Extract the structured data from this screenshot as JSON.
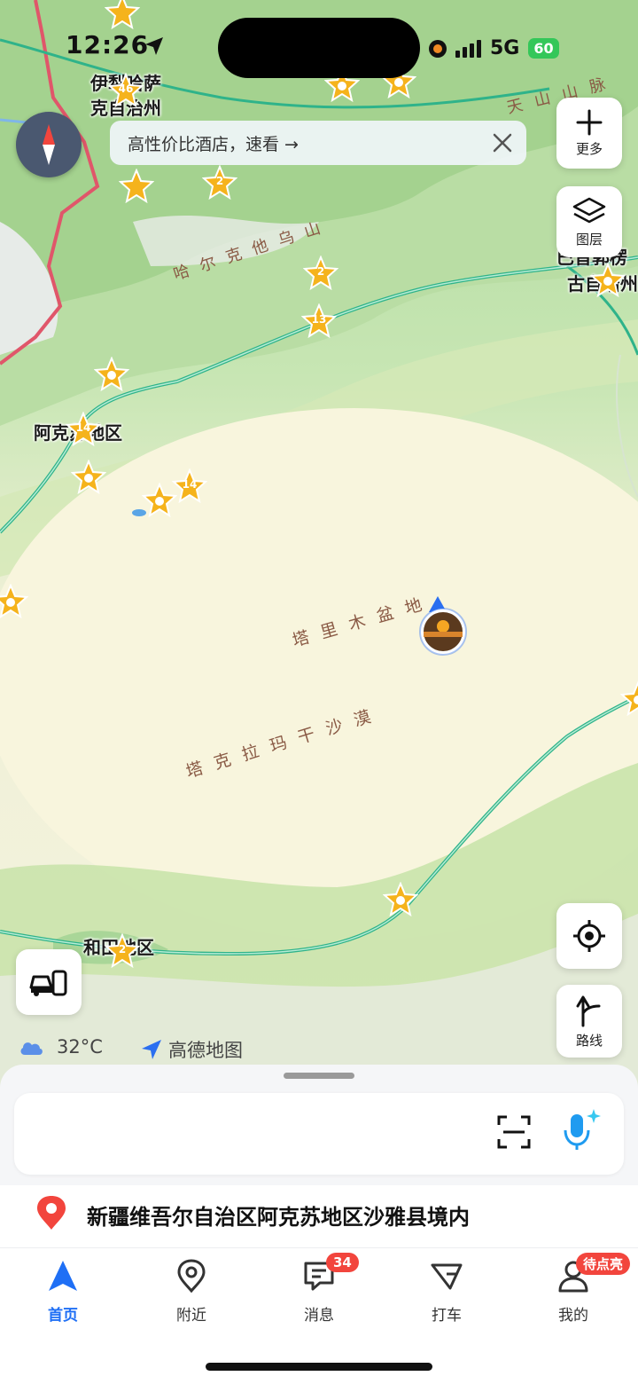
{
  "status_bar": {
    "time": "12:26",
    "network": "5G",
    "battery": "60"
  },
  "promo": {
    "text": "高性价比酒店，速看 →"
  },
  "side_buttons": {
    "more_label": "更多",
    "layers_label": "图层",
    "route_label": "路线"
  },
  "map": {
    "regions": [
      {
        "text": "天山山脉"
      },
      {
        "text": "哈尔克他乌山"
      },
      {
        "text": "塔里木盆地"
      },
      {
        "text": "塔克拉玛干沙漠"
      }
    ],
    "places": [
      {
        "text": "伊犁哈萨"
      },
      {
        "text": "克自治州"
      },
      {
        "text": "巴音郭楞"
      },
      {
        "text": "古自治州"
      },
      {
        "text": "阿克苏地区"
      },
      {
        "text": "和田地区"
      }
    ],
    "markers": [
      {
        "label": "46"
      },
      {
        "label": "2"
      },
      {
        "label": "2"
      },
      {
        "label": "13"
      },
      {
        "label": "14"
      },
      {
        "label": "14"
      },
      {
        "label": "2"
      }
    ]
  },
  "weather": {
    "temp": "32°C",
    "icon": "cloud-icon"
  },
  "brand": {
    "name": "高德地图"
  },
  "location": {
    "text": "新疆维吾尔自治区阿克苏地区沙雅县境内"
  },
  "tabs": [
    {
      "label": "首页",
      "icon": "navigation-arrow-icon",
      "active": true
    },
    {
      "label": "附近",
      "icon": "map-pin-icon"
    },
    {
      "label": "消息",
      "icon": "message-icon",
      "badge": "34"
    },
    {
      "label": "打车",
      "icon": "taxi-icon"
    },
    {
      "label": "我的",
      "icon": "user-icon",
      "badge": "待点亮"
    }
  ],
  "colors": {
    "accent": "#1f6ff5",
    "badge": "#f2453d",
    "star": "#f5b31c",
    "road": "#2fb38a"
  }
}
